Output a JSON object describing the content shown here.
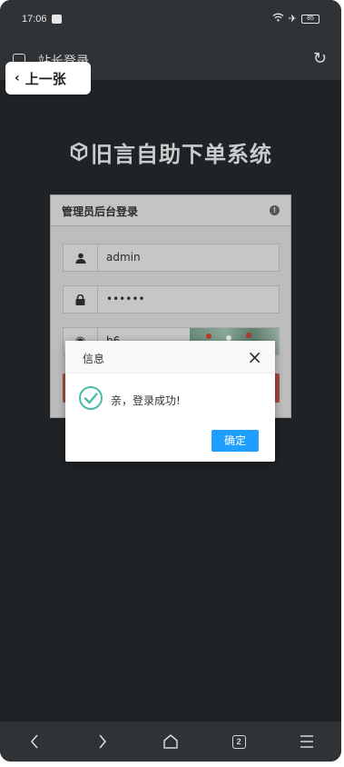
{
  "status_bar": {
    "time": "17:06",
    "battery": "85"
  },
  "browser": {
    "page_title": "站长登录",
    "tabs_count": "2"
  },
  "back_chip": {
    "label": "上一张"
  },
  "site": {
    "title": "旧言自助下单系统"
  },
  "login_panel": {
    "title": "管理员后台登录",
    "username_value": "admin",
    "password_value": "••••••",
    "captcha_value": "b6"
  },
  "dialog": {
    "title": "信息",
    "message": "亲，登录成功!",
    "confirm_label": "确定",
    "success_color": "#4cb9a6",
    "confirm_color": "#1e9fff"
  },
  "icons": {
    "wifi": "wifi-icon",
    "airplane": "airplane-icon",
    "reload": "reload-icon",
    "user": "user-icon",
    "lock": "lock-icon",
    "back": "chevron-left-icon",
    "forward": "chevron-right-icon",
    "home": "home-icon",
    "menu": "menu-icon"
  }
}
